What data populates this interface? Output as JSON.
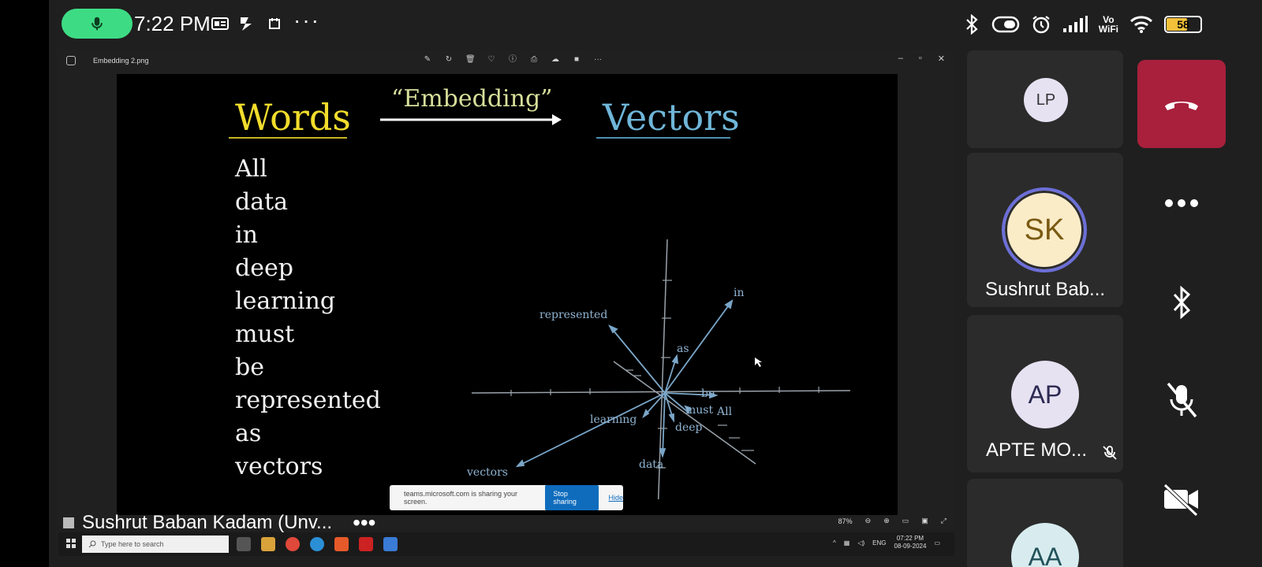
{
  "status_bar": {
    "time": "7:22 PM",
    "vo_wifi_top": "Vo",
    "vo_wifi_bottom": "WiFi",
    "battery": "58"
  },
  "shared_screen": {
    "viewer_title": "Embedding 2.png",
    "slide": {
      "left_title": "Words",
      "arrow_label": "“Embedding”",
      "right_title": "Vectors",
      "words": [
        "All",
        "data",
        "in",
        "deep",
        "learning",
        "must",
        "be",
        "represented",
        "as",
        "vectors"
      ],
      "vector_labels": {
        "in": "in",
        "represented": "represented",
        "as": "as",
        "be": "be",
        "must": "must",
        "all": "All",
        "learning": "learning",
        "deep": "deep",
        "vectors": "vectors",
        "data": "data"
      }
    },
    "share_notice": {
      "message": "teams.microsoft.com is sharing your screen.",
      "stop_label": "Stop sharing",
      "hide_label": "Hide"
    },
    "zoom_level": "87%",
    "taskbar": {
      "search_placeholder": "Type here to search",
      "language": "ENG",
      "clock_time": "07:22 PM",
      "clock_date": "08-09-2024"
    }
  },
  "presenter": {
    "name": "Sushrut Baban Kadam (Unv..."
  },
  "participants": [
    {
      "initials": "LP",
      "name": ""
    },
    {
      "initials": "SK",
      "name": "Sushrut Bab..."
    },
    {
      "initials": "AP",
      "name": "APTE MO..."
    },
    {
      "initials": "AA",
      "name": ""
    }
  ],
  "colors": {
    "mic_pill": "#3ddc84",
    "end_call": "#a8203c",
    "words_title": "#f1dc2c",
    "vectors_title": "#6fb6d8",
    "sk_avatar_bg": "#fbecc8",
    "sk_avatar_ring": "#6c6fd8",
    "default_avatar_bg": "#e6e2f2"
  }
}
